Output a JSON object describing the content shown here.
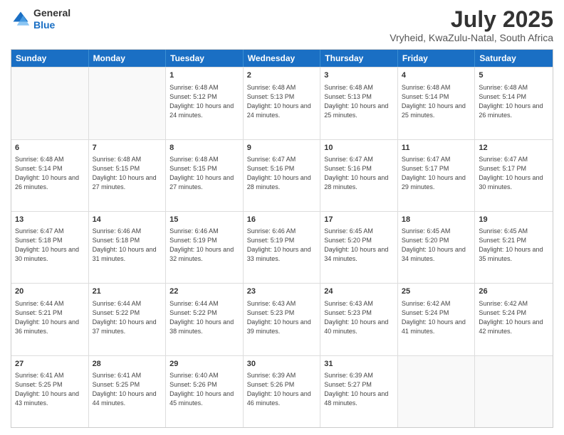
{
  "logo": {
    "general": "General",
    "blue": "Blue"
  },
  "title": "July 2025",
  "location": "Vryheid, KwaZulu-Natal, South Africa",
  "days_of_week": [
    "Sunday",
    "Monday",
    "Tuesday",
    "Wednesday",
    "Thursday",
    "Friday",
    "Saturday"
  ],
  "weeks": [
    [
      {
        "day": "",
        "info": ""
      },
      {
        "day": "",
        "info": ""
      },
      {
        "day": "1",
        "info": "Sunrise: 6:48 AM\nSunset: 5:12 PM\nDaylight: 10 hours and 24 minutes."
      },
      {
        "day": "2",
        "info": "Sunrise: 6:48 AM\nSunset: 5:13 PM\nDaylight: 10 hours and 24 minutes."
      },
      {
        "day": "3",
        "info": "Sunrise: 6:48 AM\nSunset: 5:13 PM\nDaylight: 10 hours and 25 minutes."
      },
      {
        "day": "4",
        "info": "Sunrise: 6:48 AM\nSunset: 5:14 PM\nDaylight: 10 hours and 25 minutes."
      },
      {
        "day": "5",
        "info": "Sunrise: 6:48 AM\nSunset: 5:14 PM\nDaylight: 10 hours and 26 minutes."
      }
    ],
    [
      {
        "day": "6",
        "info": "Sunrise: 6:48 AM\nSunset: 5:14 PM\nDaylight: 10 hours and 26 minutes."
      },
      {
        "day": "7",
        "info": "Sunrise: 6:48 AM\nSunset: 5:15 PM\nDaylight: 10 hours and 27 minutes."
      },
      {
        "day": "8",
        "info": "Sunrise: 6:48 AM\nSunset: 5:15 PM\nDaylight: 10 hours and 27 minutes."
      },
      {
        "day": "9",
        "info": "Sunrise: 6:47 AM\nSunset: 5:16 PM\nDaylight: 10 hours and 28 minutes."
      },
      {
        "day": "10",
        "info": "Sunrise: 6:47 AM\nSunset: 5:16 PM\nDaylight: 10 hours and 28 minutes."
      },
      {
        "day": "11",
        "info": "Sunrise: 6:47 AM\nSunset: 5:17 PM\nDaylight: 10 hours and 29 minutes."
      },
      {
        "day": "12",
        "info": "Sunrise: 6:47 AM\nSunset: 5:17 PM\nDaylight: 10 hours and 30 minutes."
      }
    ],
    [
      {
        "day": "13",
        "info": "Sunrise: 6:47 AM\nSunset: 5:18 PM\nDaylight: 10 hours and 30 minutes."
      },
      {
        "day": "14",
        "info": "Sunrise: 6:46 AM\nSunset: 5:18 PM\nDaylight: 10 hours and 31 minutes."
      },
      {
        "day": "15",
        "info": "Sunrise: 6:46 AM\nSunset: 5:19 PM\nDaylight: 10 hours and 32 minutes."
      },
      {
        "day": "16",
        "info": "Sunrise: 6:46 AM\nSunset: 5:19 PM\nDaylight: 10 hours and 33 minutes."
      },
      {
        "day": "17",
        "info": "Sunrise: 6:45 AM\nSunset: 5:20 PM\nDaylight: 10 hours and 34 minutes."
      },
      {
        "day": "18",
        "info": "Sunrise: 6:45 AM\nSunset: 5:20 PM\nDaylight: 10 hours and 34 minutes."
      },
      {
        "day": "19",
        "info": "Sunrise: 6:45 AM\nSunset: 5:21 PM\nDaylight: 10 hours and 35 minutes."
      }
    ],
    [
      {
        "day": "20",
        "info": "Sunrise: 6:44 AM\nSunset: 5:21 PM\nDaylight: 10 hours and 36 minutes."
      },
      {
        "day": "21",
        "info": "Sunrise: 6:44 AM\nSunset: 5:22 PM\nDaylight: 10 hours and 37 minutes."
      },
      {
        "day": "22",
        "info": "Sunrise: 6:44 AM\nSunset: 5:22 PM\nDaylight: 10 hours and 38 minutes."
      },
      {
        "day": "23",
        "info": "Sunrise: 6:43 AM\nSunset: 5:23 PM\nDaylight: 10 hours and 39 minutes."
      },
      {
        "day": "24",
        "info": "Sunrise: 6:43 AM\nSunset: 5:23 PM\nDaylight: 10 hours and 40 minutes."
      },
      {
        "day": "25",
        "info": "Sunrise: 6:42 AM\nSunset: 5:24 PM\nDaylight: 10 hours and 41 minutes."
      },
      {
        "day": "26",
        "info": "Sunrise: 6:42 AM\nSunset: 5:24 PM\nDaylight: 10 hours and 42 minutes."
      }
    ],
    [
      {
        "day": "27",
        "info": "Sunrise: 6:41 AM\nSunset: 5:25 PM\nDaylight: 10 hours and 43 minutes."
      },
      {
        "day": "28",
        "info": "Sunrise: 6:41 AM\nSunset: 5:25 PM\nDaylight: 10 hours and 44 minutes."
      },
      {
        "day": "29",
        "info": "Sunrise: 6:40 AM\nSunset: 5:26 PM\nDaylight: 10 hours and 45 minutes."
      },
      {
        "day": "30",
        "info": "Sunrise: 6:39 AM\nSunset: 5:26 PM\nDaylight: 10 hours and 46 minutes."
      },
      {
        "day": "31",
        "info": "Sunrise: 6:39 AM\nSunset: 5:27 PM\nDaylight: 10 hours and 48 minutes."
      },
      {
        "day": "",
        "info": ""
      },
      {
        "day": "",
        "info": ""
      }
    ]
  ]
}
